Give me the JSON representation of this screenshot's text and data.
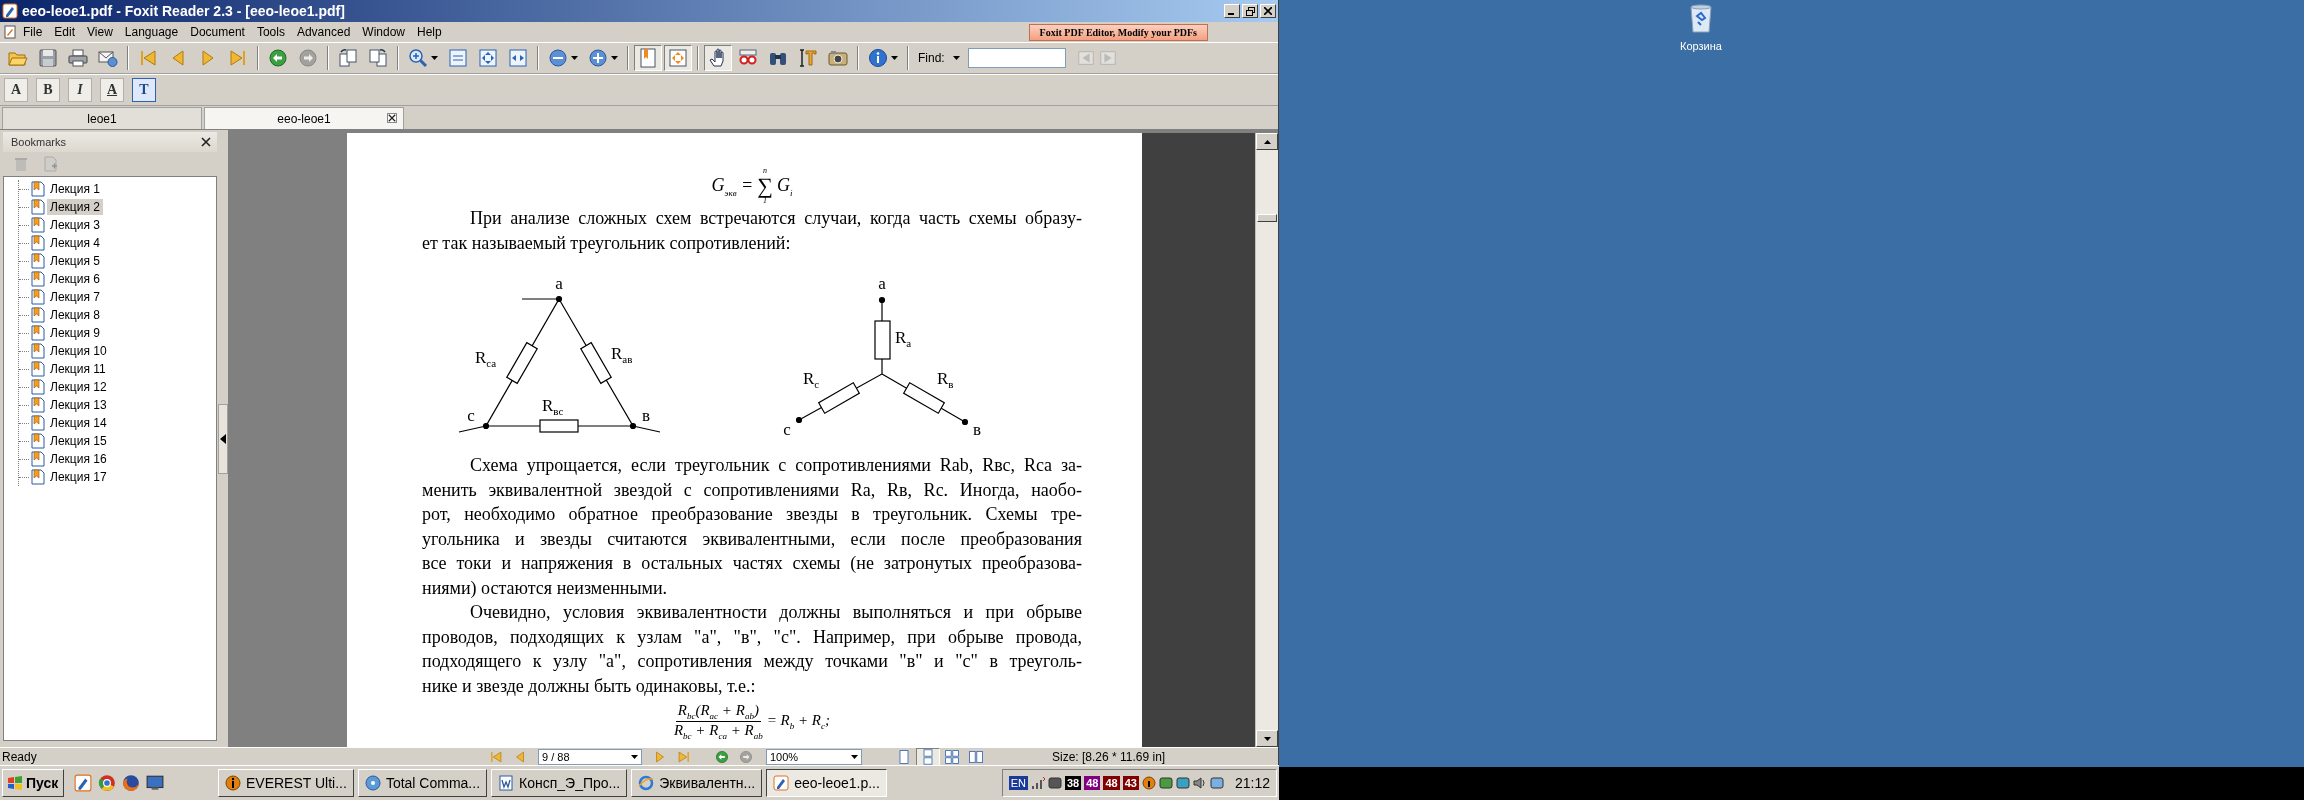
{
  "window": {
    "title": "eeo-leoe1.pdf - Foxit Reader 2.3 - [eeo-leoe1.pdf]"
  },
  "menu": [
    "File",
    "Edit",
    "View",
    "Language",
    "Document",
    "Tools",
    "Advanced",
    "Window",
    "Help"
  ],
  "ad_banner": "Foxit PDF Editor, Modify your PDFs",
  "toolbar": [
    {
      "kind": "open",
      "pressed": false,
      "disabled": false
    },
    {
      "kind": "save",
      "pressed": false,
      "disabled": false
    },
    {
      "kind": "print",
      "pressed": false,
      "disabled": false
    },
    {
      "kind": "email",
      "pressed": false,
      "disabled": false
    },
    {
      "kind": "first",
      "pressed": false,
      "disabled": false
    },
    {
      "kind": "prev",
      "pressed": false,
      "disabled": false
    },
    {
      "kind": "next",
      "pressed": false,
      "disabled": false
    },
    {
      "kind": "last",
      "pressed": false,
      "disabled": false
    },
    {
      "kind": "back",
      "pressed": false,
      "disabled": false
    },
    {
      "kind": "forward",
      "pressed": false,
      "disabled": true
    },
    {
      "kind": "rotate-left",
      "pressed": false,
      "disabled": false
    },
    {
      "kind": "rotate-right",
      "pressed": false,
      "disabled": false
    },
    {
      "kind": "zoom",
      "pressed": false,
      "disabled": false
    },
    {
      "kind": "actual-size",
      "pressed": false,
      "disabled": false
    },
    {
      "kind": "fit-page",
      "pressed": false,
      "disabled": false
    },
    {
      "kind": "fit-width",
      "pressed": false,
      "disabled": false
    },
    {
      "kind": "zoom-out",
      "pressed": false,
      "disabled": false
    },
    {
      "kind": "zoom-in",
      "pressed": false,
      "disabled": false
    },
    {
      "kind": "bookmarks",
      "pressed": true,
      "disabled": false
    },
    {
      "kind": "fit-visible",
      "pressed": true,
      "disabled": false
    },
    {
      "kind": "hand",
      "pressed": true,
      "disabled": false
    },
    {
      "kind": "reader",
      "pressed": false,
      "disabled": false
    },
    {
      "kind": "find",
      "pressed": false,
      "disabled": false
    },
    {
      "kind": "text-select",
      "pressed": false,
      "disabled": false
    },
    {
      "kind": "snapshot",
      "pressed": false,
      "disabled": false
    },
    {
      "kind": "info",
      "pressed": false,
      "disabled": false
    }
  ],
  "find": {
    "label": "Find:",
    "buttons": [
      {
        "kind": "find-prev",
        "disabled": true
      },
      {
        "kind": "find-next",
        "disabled": true
      }
    ]
  },
  "format_toolbar": [
    {
      "label": "A",
      "pressed": false
    },
    {
      "label": "B",
      "pressed": false
    },
    {
      "label": "I",
      "pressed": false
    },
    {
      "label": "A",
      "pressed": false
    },
    {
      "label": "T",
      "pressed": true
    }
  ],
  "tabs": [
    {
      "label": "leoe1",
      "selected": false
    },
    {
      "label": "eeo-leoe1",
      "selected": true
    }
  ],
  "bookmarks": {
    "title": "Bookmarks",
    "items": [
      {
        "label": "Лекция 1",
        "selected": false
      },
      {
        "label": "Лекция 2",
        "selected": true
      },
      {
        "label": "Лекция 3",
        "selected": false
      },
      {
        "label": "Лекция 4",
        "selected": false
      },
      {
        "label": "Лекция 5",
        "selected": false
      },
      {
        "label": "Лекция 6",
        "selected": false
      },
      {
        "label": "Лекция 7",
        "selected": false
      },
      {
        "label": "Лекция 8",
        "selected": false
      },
      {
        "label": "Лекция 9",
        "selected": false
      },
      {
        "label": "Лекция 10",
        "selected": false
      },
      {
        "label": "Лекция 11",
        "selected": false
      },
      {
        "label": "Лекция 12",
        "selected": false
      },
      {
        "label": "Лекция 13",
        "selected": false
      },
      {
        "label": "Лекция 14",
        "selected": false
      },
      {
        "label": "Лекция 15",
        "selected": false
      },
      {
        "label": "Лекция 16",
        "selected": false
      },
      {
        "label": "Лекция 17",
        "selected": false
      }
    ]
  },
  "document": {
    "blocks": [
      {
        "kind": "sum_formula",
        "left": "G$_{экв}$ =",
        "sign": "∑",
        "upper": "n",
        "lower": "1",
        "right": "G$_{i}$"
      },
      {
        "kind": "paragraph",
        "lines": [
          "При анализе сложных схем встречаются случаи, когда часть схемы образу-",
          "ет так называемый треугольник сопротивлений:"
        ]
      },
      {
        "kind": "diagrams",
        "items": [
          {
            "kind": "triangle",
            "nodes": [
              "а",
              "с",
              "в"
            ],
            "resistors": [
              {
                "symbol": "R",
                "subscript": "са"
              },
              {
                "symbol": "R",
                "subscript": "ав"
              },
              {
                "symbol": "R",
                "subscript": "вс"
              }
            ]
          },
          {
            "kind": "star",
            "nodes": [
              "а",
              "с",
              "в"
            ],
            "resistors": [
              {
                "symbol": "R",
                "subscript": "а"
              },
              {
                "symbol": "R",
                "subscript": "с"
              },
              {
                "symbol": "R",
                "subscript": "в"
              }
            ]
          }
        ]
      },
      {
        "kind": "paragraph",
        "lines": [
          "Схема упрощается, если треугольник с сопротивлениями Rab, Rвс, Rca за-",
          "менить эквивалентной звездой с сопротивлениями Ra, Rв, Rc. Иногда, наобо-",
          "рот, необходимо обратное преобразование звезды в треугольник. Схемы тре-",
          "угольника и звезды считаются эквивалентными, если после преобразования",
          "все токи и напряжения в остальных частях схемы (не затронутых преобразова-",
          "ниями) остаются неизменными."
        ]
      },
      {
        "kind": "paragraph",
        "lines": [
          "Очевидно, условия эквивалентности должны выполняться и при обрыве",
          "проводов, подходящих к узлам \"а\", \"в\", \"с\". Например, при обрыве провода,",
          "подходящего к узлу \"а\", сопротивления между точками \"в\" и \"с\" в треуголь-",
          "нике и звезде должны быть одинаковы, т.е.:"
        ]
      },
      {
        "kind": "fraction_formula",
        "numerator": "R$_{bc}$(R$_{ac}$ + R$_{ab}$)",
        "denominator": "R$_{bc}$ + R$_{ca}$ + R$_{ab}$",
        "right": "= R$_{b}$ + R$_{c}$;"
      }
    ]
  },
  "status_bar": {
    "text": "Ready",
    "page": "9 / 88",
    "zoom": "100%",
    "view_modes": [
      {
        "kind": "single",
        "selected": false
      },
      {
        "kind": "continuous",
        "selected": true
      },
      {
        "kind": "facing",
        "selected": false
      },
      {
        "kind": "continuous-facing",
        "selected": false
      }
    ],
    "size": "Size: [8.26 * 11.69 in]"
  },
  "taskbar": {
    "start": "Пуск",
    "tasks": [
      {
        "label": "EVEREST Ulti...",
        "selected": false
      },
      {
        "label": "Total Comma...",
        "selected": false
      },
      {
        "label": "Консп_Э_Про...",
        "selected": false
      },
      {
        "label": "Эквивалентн...",
        "selected": false
      },
      {
        "label": "eeo-leoe1.p...",
        "selected": true
      }
    ],
    "tray": {
      "language": "EN",
      "badges": [
        {
          "text": "38",
          "color": "#000000"
        },
        {
          "text": "48",
          "color": "#800080"
        },
        {
          "text": "48",
          "color": "#800000"
        },
        {
          "text": "43",
          "color": "#800000"
        }
      ],
      "time": "21:12"
    }
  },
  "desktop": {
    "icons": [
      {
        "label": "Корзина"
      }
    ]
  }
}
